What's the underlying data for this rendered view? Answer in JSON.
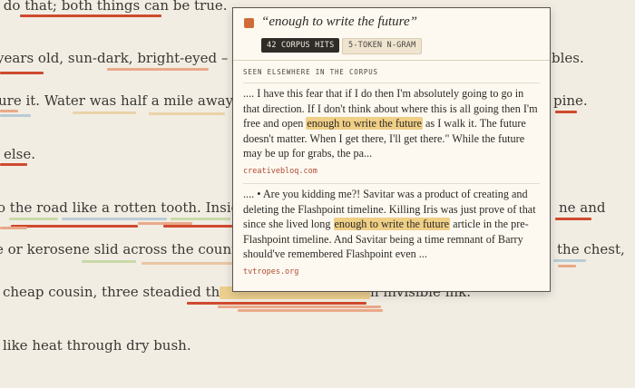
{
  "document": {
    "lines": [
      "if I do that; both things can be true.",
      "years old, sun-dark, bright-eyed – chased a",
      "bles.",
      "ure it. Water was half a mile away; every c",
      "pine.",
      "else.",
      "o the road like a rotten tooth. Inside, boa",
      "ne and",
      "e or kerosene slid across the counter and",
      "the chest,",
      "cheap cousin, three steadied the hand",
      "n invisible ink.",
      "like heat through dry bush."
    ]
  },
  "popup": {
    "phrase": "“enough to write the future”",
    "hits_badge": "42 CORPUS HITS",
    "ngram_badge": "5-TOKEN N-GRAM",
    "section_title": "SEEN ELSEWHERE IN THE CORPUS",
    "excerpts": [
      {
        "before": ".... I have this fear that if I do then I'm absolutely going to go in that direction. If I don't think about where this is all going then I'm free and open ",
        "match": "enough to write the future",
        "after": " as I walk it. The future doesn't matter. When I get there, I'll get there.\" While the future may be up for grabs, the pa...",
        "source": "creativebloq.com"
      },
      {
        "before": ".... • Are you kidding me?! Savitar was a product of creating and deleting the Flashpoint timeline. Killing Iris was just prove of that since she lived long ",
        "match": "enough to write the future",
        "after": " article in the pre-Flashpoint timeline. And Savitar being a time remnant of Barry should've remembered Flashpoint even ...",
        "source": "tvtropes.org"
      }
    ]
  },
  "colors": {
    "accent": "#d06a36",
    "highlight": "#f0cf86",
    "source_link": "#b24a35",
    "underline_red": "#cf4a2e",
    "underline_orange": "#e9a98a",
    "underline_green": "#c9d9a8",
    "underline_blue": "#b9ccd6"
  }
}
